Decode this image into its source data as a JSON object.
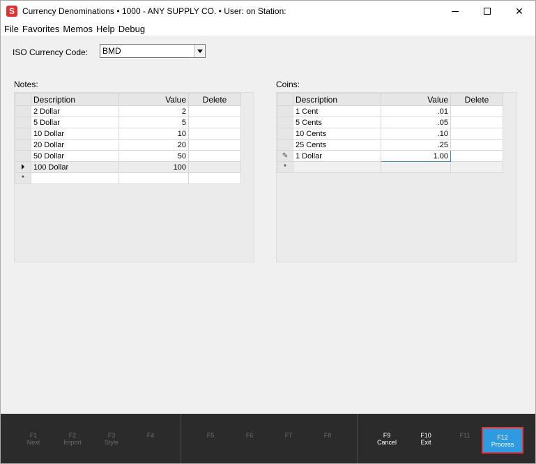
{
  "titlebar": {
    "app_icon_letter": "S",
    "title": "Currency Denominations  •  1000 - ANY SUPPLY CO.  •  User:              on Station:"
  },
  "menu": [
    "File",
    "Favorites",
    "Memos",
    "Help",
    "Debug"
  ],
  "iso": {
    "label": "ISO Currency Code:",
    "value": "BMD"
  },
  "notes": {
    "label": "Notes:",
    "columns": [
      "Description",
      "Value",
      "Delete"
    ],
    "rows": [
      {
        "description": "2 Dollar",
        "value": "2"
      },
      {
        "description": "5 Dollar",
        "value": "5"
      },
      {
        "description": "10 Dollar",
        "value": "10"
      },
      {
        "description": "20 Dollar",
        "value": "20"
      },
      {
        "description": "50 Dollar",
        "value": "50"
      },
      {
        "description": "100 Dollar",
        "value": "100"
      }
    ],
    "new_row_marker": "*"
  },
  "coins": {
    "label": "Coins:",
    "columns": [
      "Description",
      "Value",
      "Delete"
    ],
    "rows": [
      {
        "description": "1 Cent",
        "value": ".01"
      },
      {
        "description": "5 Cents",
        "value": ".05"
      },
      {
        "description": "10 Cents",
        "value": ".10"
      },
      {
        "description": "25 Cents",
        "value": ".25"
      },
      {
        "description": "1 Dollar",
        "value": "1.00"
      }
    ],
    "new_row_marker": "*"
  },
  "fkeys": [
    {
      "key": "F1",
      "label": "Next",
      "enabled": false
    },
    {
      "key": "F2",
      "label": "Import",
      "enabled": false
    },
    {
      "key": "F3",
      "label": "Style",
      "enabled": false
    },
    {
      "key": "F4",
      "label": "",
      "enabled": false
    },
    {
      "key": "F5",
      "label": "",
      "enabled": false
    },
    {
      "key": "F6",
      "label": "",
      "enabled": false
    },
    {
      "key": "F7",
      "label": "",
      "enabled": false
    },
    {
      "key": "F8",
      "label": "",
      "enabled": false
    },
    {
      "key": "F9",
      "label": "Cancel",
      "enabled": true
    },
    {
      "key": "F10",
      "label": "Exit",
      "enabled": true
    },
    {
      "key": "F11",
      "label": "",
      "enabled": false
    },
    {
      "key": "F12",
      "label": "Process",
      "enabled": true
    }
  ],
  "colors": {
    "accent": "#2e9be0",
    "highlight_border": "#e33333",
    "footer_bg": "#2b2b2b"
  }
}
